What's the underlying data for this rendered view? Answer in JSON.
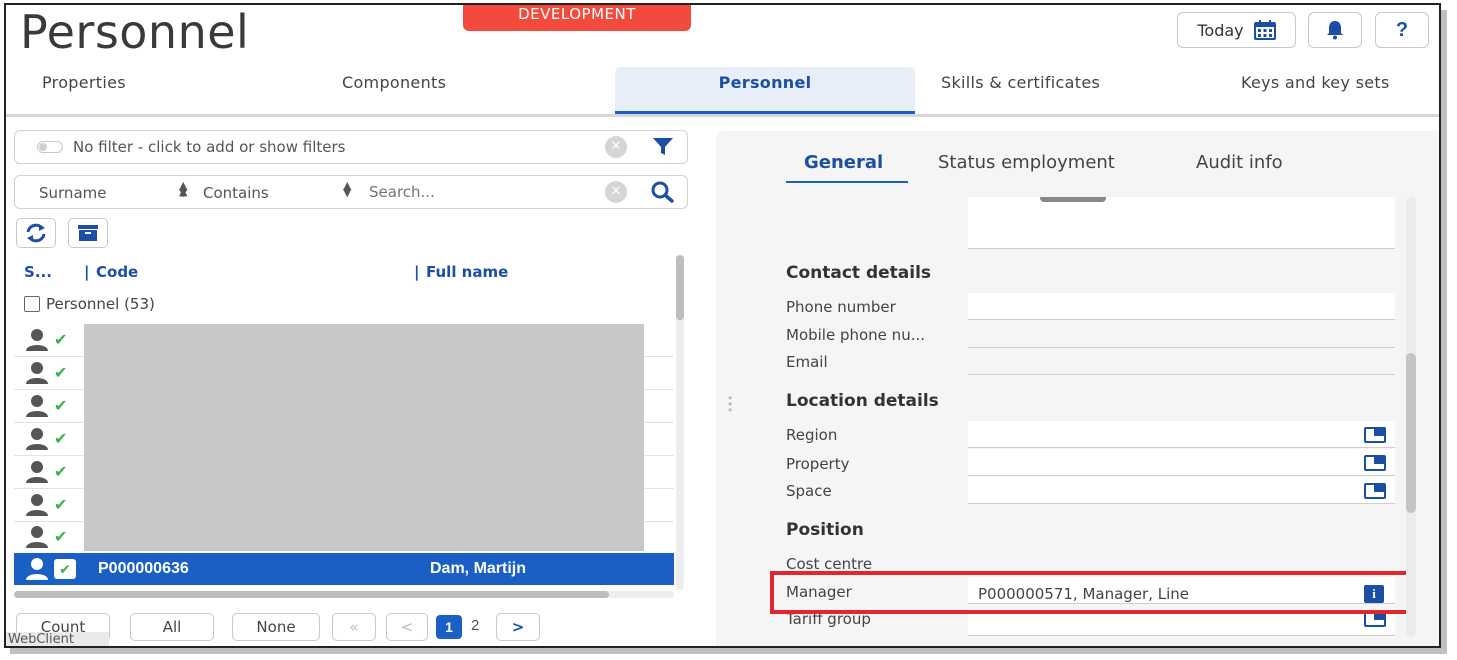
{
  "header": {
    "title": "Personnel",
    "environment_badge": "DEVELOPMENT",
    "today_label": "Today",
    "help_label": "?"
  },
  "tabs": [
    {
      "label": "Properties"
    },
    {
      "label": "Components"
    },
    {
      "label": "Personnel",
      "active": true
    },
    {
      "label": "Skills & certificates"
    },
    {
      "label": "Keys and key sets"
    }
  ],
  "filter": {
    "text": "No filter - click to add or show filters"
  },
  "search": {
    "field": "Surname",
    "operator": "Contains",
    "placeholder": "Search..."
  },
  "grid": {
    "columns": [
      "S...",
      "Code",
      "Full name"
    ],
    "group_label": "Personnel (53)",
    "selected_row": {
      "code": "P000000636",
      "full_name": "Dam, Martijn"
    }
  },
  "pager": {
    "count_label": "Count",
    "all_label": "All",
    "none_label": "None",
    "first_label": "«",
    "prev_label": "<",
    "next_label": ">",
    "pages": [
      "1",
      "2"
    ],
    "current_page": "1"
  },
  "footer": {
    "webclient": "WebClient"
  },
  "detail": {
    "subtabs": [
      "General",
      "Status employment",
      "Audit info"
    ],
    "sections": {
      "contact": "Contact details",
      "location": "Location details",
      "position": "Position"
    },
    "fields": {
      "phone": "Phone number",
      "mobile": "Mobile phone nu...",
      "email": "Email",
      "region": "Region",
      "property": "Property",
      "space": "Space",
      "cost_centre": "Cost centre",
      "manager": "Manager",
      "tariff_group": "Tariff group"
    },
    "manager_value": "P000000571, Manager, Line"
  },
  "colors": {
    "accent": "#1a5fc4",
    "brand_blue": "#1a4fa3",
    "dev_badge": "#f24b3e",
    "highlight": "#e0282d",
    "check_green": "#3cb04b"
  }
}
